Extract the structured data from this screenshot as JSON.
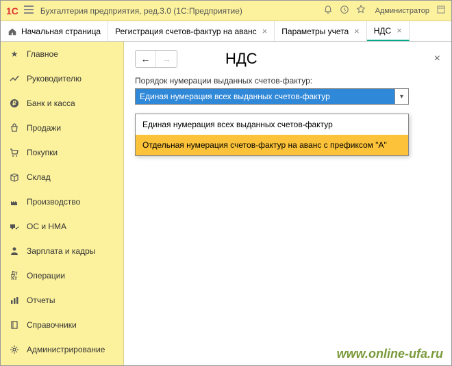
{
  "titlebar": {
    "logo": "1C",
    "title": "Бухгалтерия предприятия, ред.3.0  (1С:Предприятие)",
    "user": "Администратор"
  },
  "tabs": {
    "home": "Начальная страница",
    "items": [
      {
        "label": "Регистрация счетов-фактур на аванс"
      },
      {
        "label": "Параметры учета"
      },
      {
        "label": "НДС"
      }
    ]
  },
  "sidebar": {
    "items": [
      {
        "icon": "star",
        "label": "Главное"
      },
      {
        "icon": "trend",
        "label": "Руководителю"
      },
      {
        "icon": "ruble",
        "label": "Банк и касса"
      },
      {
        "icon": "bag",
        "label": "Продажи"
      },
      {
        "icon": "cart",
        "label": "Покупки"
      },
      {
        "icon": "box",
        "label": "Склад"
      },
      {
        "icon": "factory",
        "label": "Производство"
      },
      {
        "icon": "truck",
        "label": "ОС и НМА"
      },
      {
        "icon": "person",
        "label": "Зарплата и кадры"
      },
      {
        "icon": "dtkt",
        "label": "Операции"
      },
      {
        "icon": "chart",
        "label": "Отчеты"
      },
      {
        "icon": "book",
        "label": "Справочники"
      },
      {
        "icon": "gear",
        "label": "Администрирование"
      }
    ]
  },
  "content": {
    "title": "НДС",
    "field_label": "Порядок нумерации выданных счетов-фактур:",
    "selected": "Единая нумерация всех выданных счетов-фактур",
    "options": [
      "Единая нумерация всех выданных счетов-фактур",
      "Отдельная нумерация счетов-фактур на аванс с префиксом \"А\""
    ]
  },
  "watermark": "www.online-ufa.ru"
}
